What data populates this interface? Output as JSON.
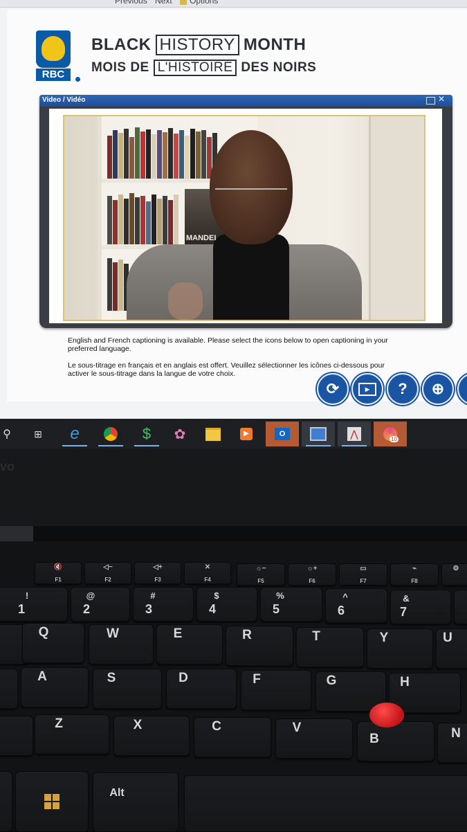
{
  "browser": {
    "nav_previous": "Previous",
    "nav_next": "Next",
    "nav_options": "Options"
  },
  "logo": {
    "text": "RBC"
  },
  "title": {
    "line1_before": "BLACK",
    "line1_boxed": "HISTORY",
    "line1_after": "MONTH",
    "line2_before": "MOIS DE",
    "line2_boxed": "L'HISTOIRE",
    "line2_after": "DES NOIRS"
  },
  "video": {
    "window_title": "Video / Vidéo",
    "poster_text": "MANDEL"
  },
  "captions": {
    "english": "English and French captioning is available.  Please select the icons below to open captioning in your preferred language.",
    "french": "Le sous-titrage en français et en anglais est offert.  Veuillez sélectionner les icônes ci-dessous pour activer le sous-titrage dans la langue de votre choix."
  },
  "controls": [
    {
      "icon": "replay-icon"
    },
    {
      "icon": "captions-icon"
    },
    {
      "icon": "help-icon",
      "label": "?"
    },
    {
      "icon": "globe-icon"
    },
    {
      "icon": "globe-icon"
    }
  ],
  "taskbar": {
    "apps": [
      "search",
      "task-view",
      "internet-explorer",
      "chrome",
      "excel-like",
      "paint",
      "file-explorer",
      "media-player",
      "outlook",
      "network-app",
      "acrobat",
      "notifications"
    ],
    "badge_count": "10"
  },
  "laptop": {
    "brand": "vo"
  },
  "keyboard": {
    "fn_row": [
      {
        "top": "🔇",
        "bot": "F1"
      },
      {
        "top": "◁−",
        "bot": "F2"
      },
      {
        "top": "◁+",
        "bot": "F3"
      },
      {
        "top": "✕",
        "bot": "F4"
      },
      {
        "top": "☼−",
        "bot": "F5"
      },
      {
        "top": "☼+",
        "bot": "F6"
      },
      {
        "top": "▭",
        "bot": "F7"
      },
      {
        "top": "⌁",
        "bot": "F8"
      },
      {
        "top": "⚙",
        "bot": ""
      }
    ],
    "num_row": [
      {
        "top": "!",
        "bot": "1"
      },
      {
        "top": "@",
        "bot": "2"
      },
      {
        "top": "#",
        "bot": "3"
      },
      {
        "top": "$",
        "bot": "4"
      },
      {
        "top": "%",
        "bot": "5"
      },
      {
        "top": "^",
        "bot": "6"
      },
      {
        "top": "&",
        "bot": "7"
      }
    ],
    "row_q": [
      "Q",
      "W",
      "E",
      "R",
      "T",
      "Y",
      "U"
    ],
    "row_a": [
      "A",
      "S",
      "D",
      "F",
      "G",
      "H"
    ],
    "row_z": [
      "Z",
      "X",
      "C",
      "V",
      "B",
      "N"
    ],
    "alt": "Alt"
  }
}
